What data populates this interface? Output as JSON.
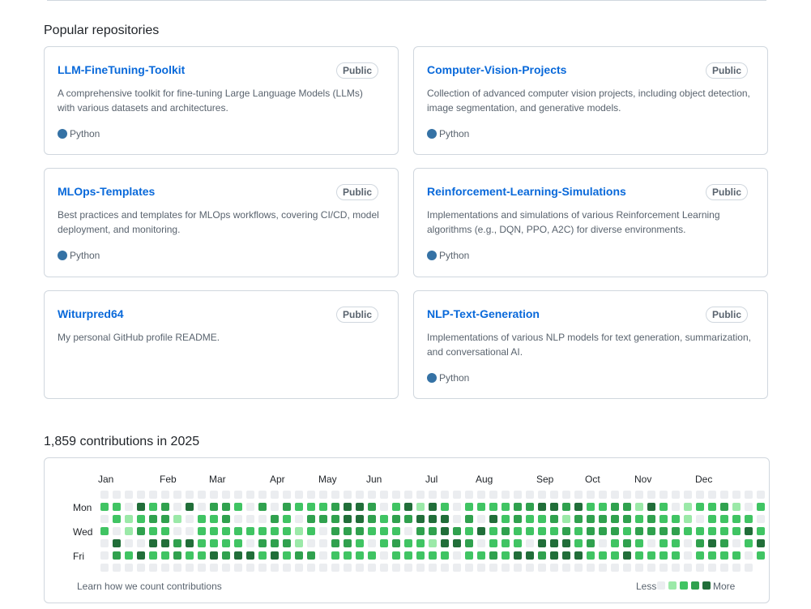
{
  "repos_section": {
    "title": "Popular repositories",
    "repos": [
      {
        "name": "LLM-FineTuning-Toolkit",
        "visibility": "Public",
        "description": "A comprehensive toolkit for fine-tuning Large Language Models (LLMs) with various datasets and architectures.",
        "language": "Python",
        "language_color": "#3572A5"
      },
      {
        "name": "Computer-Vision-Projects",
        "visibility": "Public",
        "description": "Collection of advanced computer vision projects, including object detection, image segmentation, and generative models.",
        "language": "Python",
        "language_color": "#3572A5"
      },
      {
        "name": "MLOps-Templates",
        "visibility": "Public",
        "description": "Best practices and templates for MLOps workflows, covering CI/CD, model deployment, and monitoring.",
        "language": "Python",
        "language_color": "#3572A5"
      },
      {
        "name": "Reinforcement-Learning-Simulations",
        "visibility": "Public",
        "description": "Implementations and simulations of various Reinforcement Learning algorithms (e.g., DQN, PPO, A2C) for diverse environments.",
        "language": "Python",
        "language_color": "#3572A5"
      },
      {
        "name": "Witurpred64",
        "visibility": "Public",
        "description": "My personal GitHub profile README.",
        "language": "",
        "language_color": ""
      },
      {
        "name": "NLP-Text-Generation",
        "visibility": "Public",
        "description": "Implementations of various NLP models for text generation, summarization, and conversational AI.",
        "language": "Python",
        "language_color": "#3572A5"
      }
    ]
  },
  "contributions": {
    "title": "1,859 contributions in 2025",
    "months": [
      "Jan",
      "Feb",
      "Mar",
      "Apr",
      "May",
      "Jun",
      "Jul",
      "Aug",
      "Sep",
      "Oct",
      "Nov",
      "Dec"
    ],
    "day_labels": [
      "Mon",
      "Wed",
      "Fri"
    ],
    "footer_link": "Learn how we count contributions",
    "legend_less": "Less",
    "legend_more": "More",
    "level_colors": [
      "#ebedf0",
      "#9be9a8",
      "#40c463",
      "#30a14e",
      "#216e39"
    ],
    "grid_levels": [
      "0000000000000000000000000000000000000000000000000000000",
      "2204230403320303222344302414202222334434223314201223102",
      "0212331022300032033344323344403042322313333323221022220",
      "2013220022222222120333222033432423222232333233332222242",
      "0400443422220333100332023221443022204442302320220343024",
      "0324223224344242330222202222202232443444222422220222202",
      "0000000000000000000000000000000000000000000000000000000"
    ]
  }
}
